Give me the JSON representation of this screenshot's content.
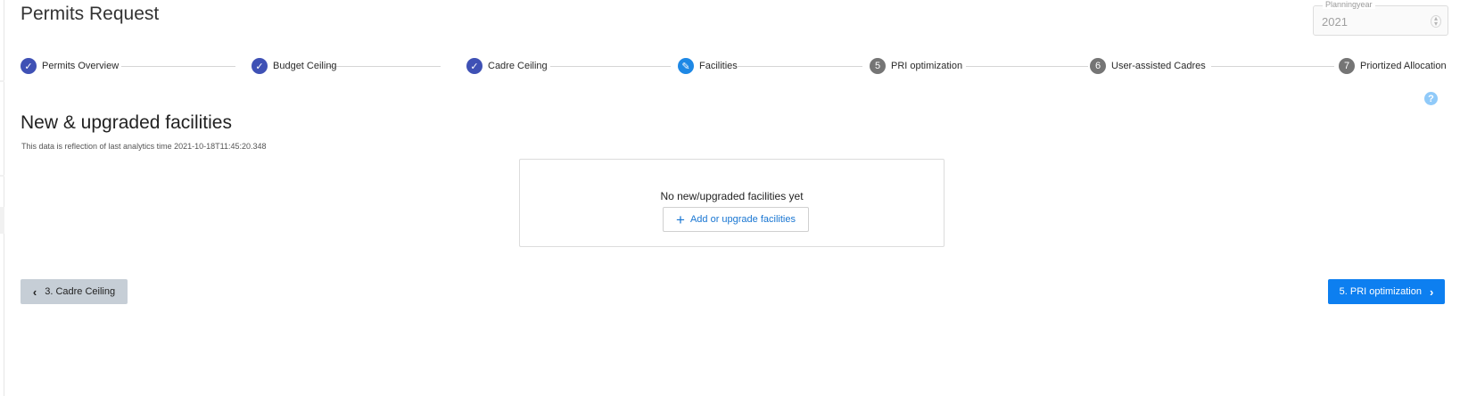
{
  "page": {
    "title": "Permits Request",
    "planning_year_label": "Planningyear",
    "planning_year_value": "2021"
  },
  "stepper": {
    "steps": [
      {
        "label": "Permits Overview",
        "marker": "✓",
        "state": "completed"
      },
      {
        "label": "Budget Ceiling",
        "marker": "✓",
        "state": "completed"
      },
      {
        "label": "Cadre Ceiling",
        "marker": "✓",
        "state": "completed"
      },
      {
        "label": "Facilities",
        "marker": "✎",
        "state": "active"
      },
      {
        "label": "PRI optimization",
        "marker": "5",
        "state": "pending"
      },
      {
        "label": "User-assisted Cadres",
        "marker": "6",
        "state": "pending"
      },
      {
        "label": "Priortized Allocation",
        "marker": "7",
        "state": "pending"
      }
    ]
  },
  "help": {
    "glyph": "?"
  },
  "section": {
    "title": "New & upgraded facilities",
    "analytics_note": "This data is reflection of last analytics time 2021-10-18T11:45:20.348"
  },
  "empty_state": {
    "message": "No new/upgraded facilities yet",
    "add_icon": "+",
    "add_label": "Add or upgrade facilities"
  },
  "navigation": {
    "prev_label": "3. Cadre Ceiling",
    "next_label": "5. PRI optimization",
    "prev_icon": "‹",
    "next_icon": "›"
  },
  "colors": {
    "completed": "#3f51b5",
    "active": "#1e88e5",
    "pending": "#757575",
    "primary_button": "#0d7ff0",
    "secondary_button": "#c6ced6"
  }
}
